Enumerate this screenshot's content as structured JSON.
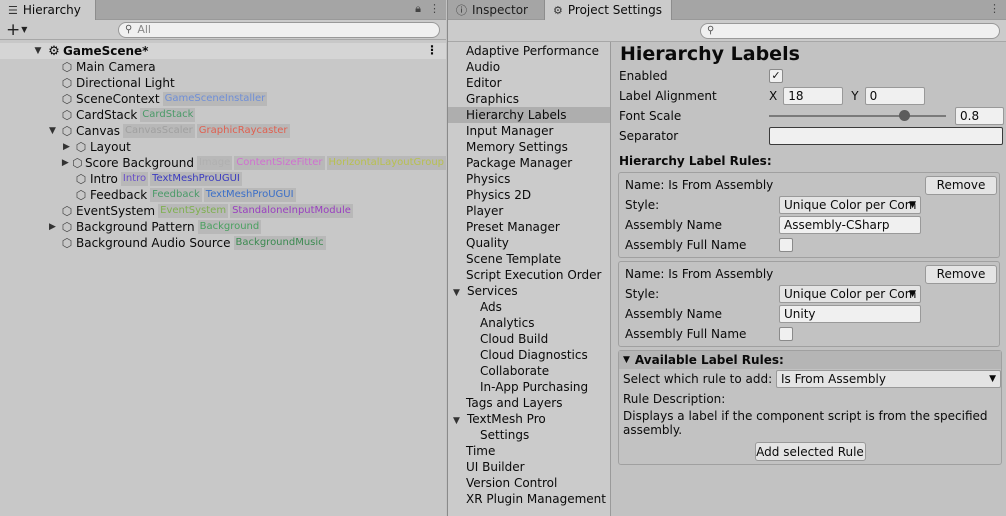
{
  "hierarchy": {
    "tab_label": "Hierarchy",
    "search_placeholder": "All",
    "scene_name": "GameScene*",
    "rows": [
      {
        "name": "Main Camera",
        "depth": 1,
        "fold": "",
        "labels": []
      },
      {
        "name": "Directional Light",
        "depth": 1,
        "fold": "",
        "labels": []
      },
      {
        "name": "SceneContext",
        "depth": 1,
        "fold": "",
        "labels": [
          {
            "text": "GameSceneInstaller",
            "color": "#6f8fd8"
          }
        ]
      },
      {
        "name": "CardStack",
        "depth": 1,
        "fold": "",
        "labels": [
          {
            "text": "CardStack",
            "color": "#4a9a68"
          }
        ]
      },
      {
        "name": "Canvas",
        "depth": 1,
        "fold": "open",
        "labels": [
          {
            "text": "CanvasScaler",
            "color": "#a0a0a0"
          },
          {
            "text": "GraphicRaycaster",
            "color": "#e06050"
          }
        ]
      },
      {
        "name": "Layout",
        "depth": 2,
        "fold": "closed",
        "labels": []
      },
      {
        "name": "Score Background",
        "depth": 2,
        "fold": "closed",
        "labels": [
          {
            "text": "Image",
            "color": "#b0b0b0"
          },
          {
            "text": "ContentSizeFitter",
            "color": "#d070d0"
          },
          {
            "text": "HorizontalLayoutGroup",
            "color": "#b8c050"
          }
        ]
      },
      {
        "name": "Intro",
        "depth": 2,
        "fold": "",
        "labels": [
          {
            "text": "Intro",
            "color": "#6a50c8"
          },
          {
            "text": "TextMeshProUGUI",
            "color": "#3b3bc0"
          }
        ]
      },
      {
        "name": "Feedback",
        "depth": 2,
        "fold": "",
        "labels": [
          {
            "text": "Feedback",
            "color": "#4a9a68"
          },
          {
            "text": "TextMeshProUGUI",
            "color": "#3b6fc8"
          }
        ]
      },
      {
        "name": "EventSystem",
        "depth": 1,
        "fold": "",
        "labels": [
          {
            "text": "EventSystem",
            "color": "#7fb050"
          },
          {
            "text": "StandaloneInputModule",
            "color": "#9a40c0"
          }
        ]
      },
      {
        "name": "Background Pattern",
        "depth": 1,
        "fold": "closed",
        "labels": [
          {
            "text": "Background",
            "color": "#4aa060"
          }
        ]
      },
      {
        "name": "Background Audio Source",
        "depth": 1,
        "fold": "",
        "labels": [
          {
            "text": "BackgroundMusic",
            "color": "#3b8a50"
          }
        ]
      }
    ]
  },
  "tabs": {
    "inspector": "Inspector",
    "project_settings": "Project Settings"
  },
  "settings_list": [
    {
      "label": "Adaptive Performance",
      "kind": "item"
    },
    {
      "label": "Audio",
      "kind": "item"
    },
    {
      "label": "Editor",
      "kind": "item"
    },
    {
      "label": "Graphics",
      "kind": "item"
    },
    {
      "label": "Hierarchy Labels",
      "kind": "selected"
    },
    {
      "label": "Input Manager",
      "kind": "item"
    },
    {
      "label": "Memory Settings",
      "kind": "item"
    },
    {
      "label": "Package Manager",
      "kind": "item"
    },
    {
      "label": "Physics",
      "kind": "item"
    },
    {
      "label": "Physics 2D",
      "kind": "item"
    },
    {
      "label": "Player",
      "kind": "item"
    },
    {
      "label": "Preset Manager",
      "kind": "item"
    },
    {
      "label": "Quality",
      "kind": "item"
    },
    {
      "label": "Scene Template",
      "kind": "item"
    },
    {
      "label": "Script Execution Order",
      "kind": "item"
    },
    {
      "label": "Services",
      "kind": "group"
    },
    {
      "label": "Ads",
      "kind": "child"
    },
    {
      "label": "Analytics",
      "kind": "child"
    },
    {
      "label": "Cloud Build",
      "kind": "child"
    },
    {
      "label": "Cloud Diagnostics",
      "kind": "child"
    },
    {
      "label": "Collaborate",
      "kind": "child"
    },
    {
      "label": "In-App Purchasing",
      "kind": "child"
    },
    {
      "label": "Tags and Layers",
      "kind": "item"
    },
    {
      "label": "TextMesh Pro",
      "kind": "group"
    },
    {
      "label": "Settings",
      "kind": "child"
    },
    {
      "label": "Time",
      "kind": "item"
    },
    {
      "label": "UI Builder",
      "kind": "item"
    },
    {
      "label": "Version Control",
      "kind": "item"
    },
    {
      "label": "XR Plugin Management",
      "kind": "item"
    }
  ],
  "content": {
    "title": "Hierarchy Labels",
    "enabled_label": "Enabled",
    "enabled_mark": "✓",
    "alignment_label": "Label Alignment",
    "x_label": "X",
    "x_value": "18",
    "y_label": "Y",
    "y_value": "0",
    "font_scale_label": "Font Scale",
    "font_scale_value": "0.8",
    "separator_label": "Separator",
    "separator_value": "",
    "rules_heading": "Hierarchy Label Rules:",
    "rules": [
      {
        "name_text": "Name: Is From Assembly",
        "remove_label": "Remove",
        "style_label": "Style:",
        "style_value": "Unique Color per Com",
        "assembly_label": "Assembly Name",
        "assembly_value": "Assembly-CSharp",
        "fullname_label": "Assembly Full Name"
      },
      {
        "name_text": "Name: Is From Assembly",
        "remove_label": "Remove",
        "style_label": "Style:",
        "style_value": "Unique Color per Com",
        "assembly_label": "Assembly Name",
        "assembly_value": "Unity",
        "fullname_label": "Assembly Full Name"
      }
    ],
    "available": {
      "heading": "Available Label Rules:",
      "select_label": "Select which rule to add:",
      "select_value": "Is From Assembly",
      "desc_label": "Rule Description:",
      "desc_text": "Displays a label if the component script is from the specified assembly.",
      "add_button": "Add selected Rule"
    }
  }
}
